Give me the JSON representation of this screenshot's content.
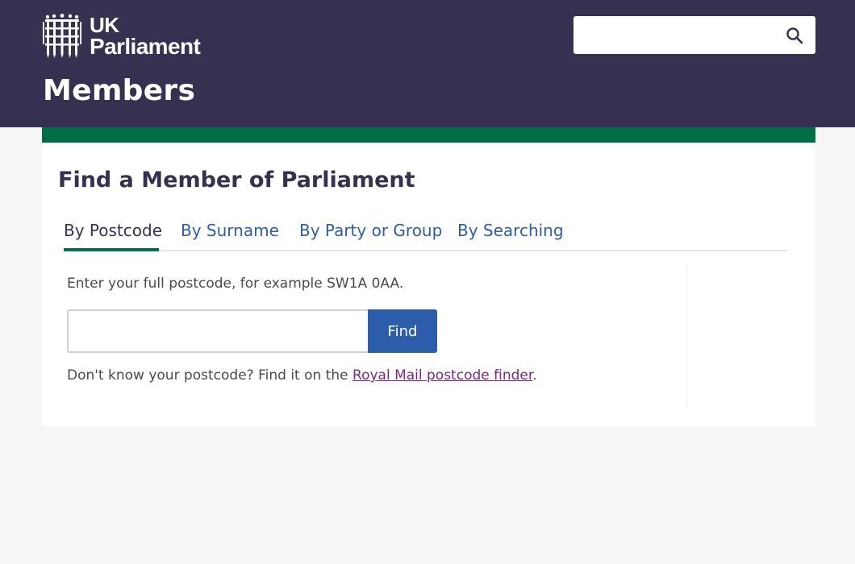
{
  "header": {
    "logo": {
      "line1": "UK",
      "line2": "Parliament",
      "icon": "portcullis-icon"
    },
    "section_title": "Members",
    "search": {
      "placeholder": "",
      "value": "",
      "icon": "search-icon"
    }
  },
  "card": {
    "title": "Find a Member of Parliament",
    "tabs": [
      {
        "label": "By Postcode",
        "active": true
      },
      {
        "label": "By Surname",
        "active": false
      },
      {
        "label": "By Party or Group",
        "active": false
      },
      {
        "label": "By Searching",
        "active": false
      }
    ],
    "postcode_form": {
      "hint": "Enter your full postcode, for example SW1A 0AA.",
      "input_value": "",
      "button_label": "Find",
      "footer_text_before": "Don't know your postcode? Find it on the ",
      "footer_link": "Royal Mail postcode finder",
      "footer_text_after": "."
    }
  },
  "colors": {
    "header_bg": "#373151",
    "accent_green": "#006e46",
    "link_blue": "#2c5dab",
    "visited_link_purple": "#7c2683",
    "page_bg": "#f6f6f6"
  }
}
